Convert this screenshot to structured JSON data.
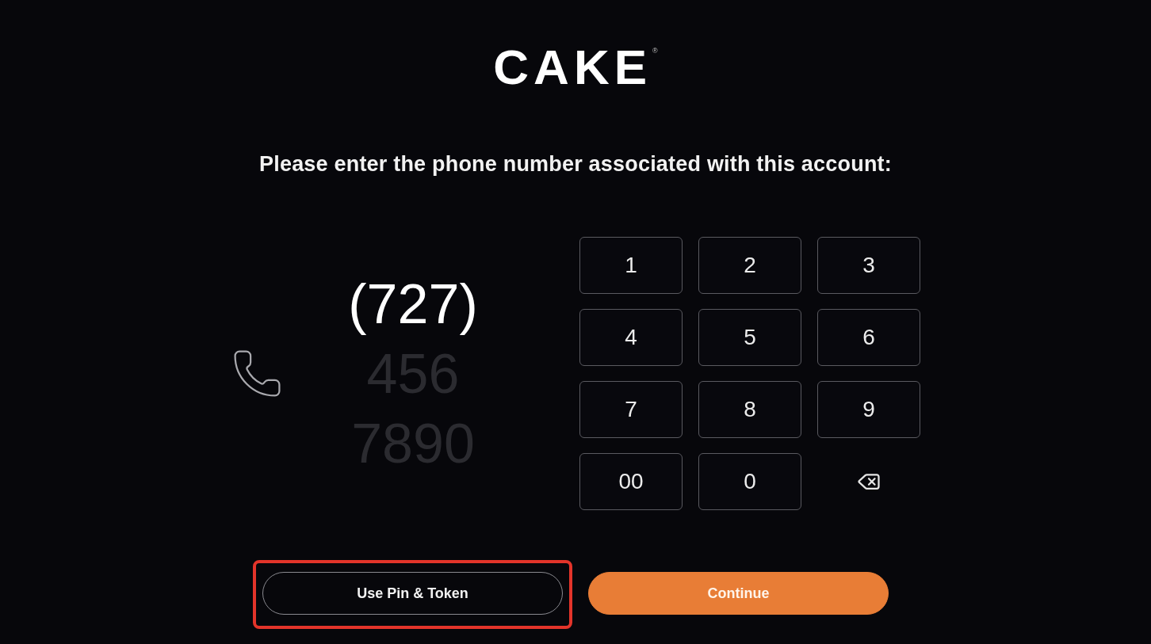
{
  "logo": {
    "text": "CAKE",
    "mark": "®"
  },
  "prompt": "Please enter the phone number associated with this account:",
  "phone_display": {
    "lines": [
      {
        "text": "(727)",
        "filled": true
      },
      {
        "text": "456",
        "filled": false
      },
      {
        "text": "7890",
        "filled": false
      }
    ]
  },
  "keypad": {
    "keys": [
      {
        "kind": "digit",
        "label": "1"
      },
      {
        "kind": "digit",
        "label": "2"
      },
      {
        "kind": "digit",
        "label": "3"
      },
      {
        "kind": "digit",
        "label": "4"
      },
      {
        "kind": "digit",
        "label": "5"
      },
      {
        "kind": "digit",
        "label": "6"
      },
      {
        "kind": "digit",
        "label": "7"
      },
      {
        "kind": "digit",
        "label": "8"
      },
      {
        "kind": "digit",
        "label": "9"
      },
      {
        "kind": "digit",
        "label": "00"
      },
      {
        "kind": "digit",
        "label": "0"
      },
      {
        "kind": "backspace"
      }
    ]
  },
  "actions": [
    {
      "kind": "secondary",
      "label": "Use Pin & Token",
      "highlighted": true
    },
    {
      "kind": "primary",
      "label": "Continue",
      "highlighted": false
    }
  ]
}
